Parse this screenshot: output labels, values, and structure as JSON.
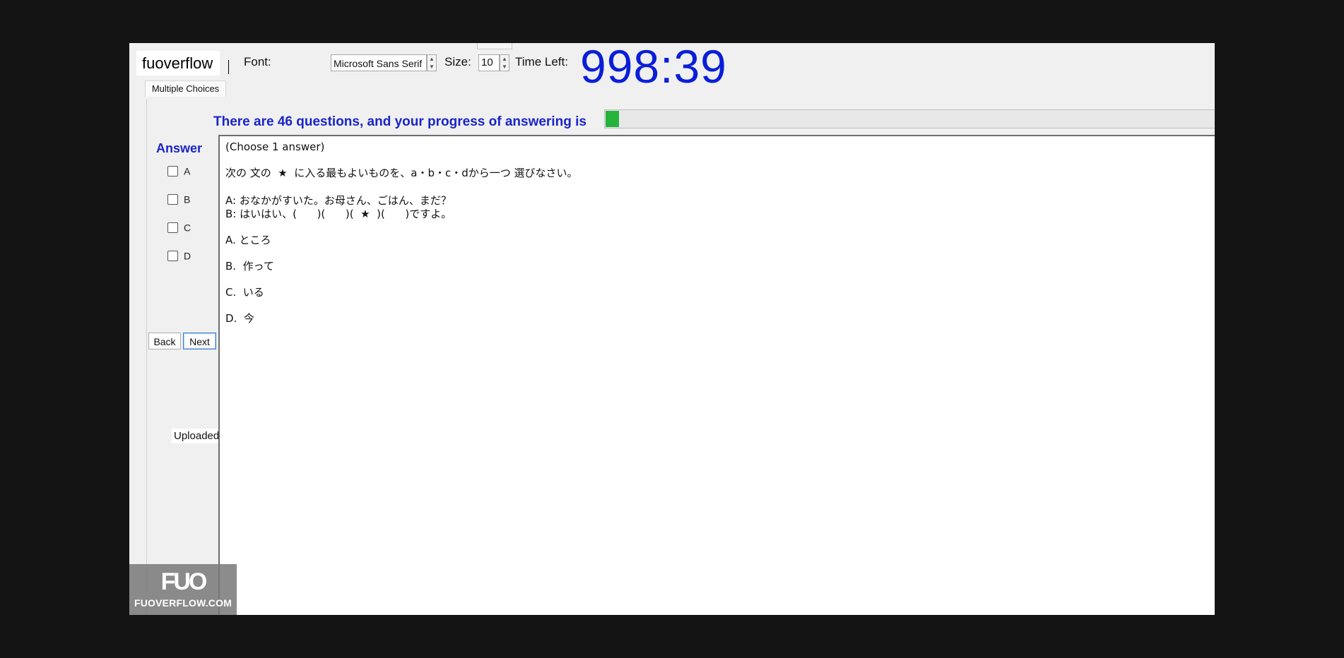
{
  "toolbar": {
    "brand": "fuoverflow",
    "font_label": "Font:",
    "font_value": "Microsoft Sans Serif",
    "size_label": "Size:",
    "size_value": "10",
    "time_left_label": "Time Left:",
    "timer": "998:39"
  },
  "tabs": [
    {
      "label": "Multiple Choices",
      "active": true
    }
  ],
  "progress": {
    "text": "There are 46 questions, and your progress of answering is",
    "fraction": 0.022,
    "fill_color": "#26b33c"
  },
  "answer": {
    "title": "Answer",
    "options": [
      {
        "letter": "A",
        "checked": false
      },
      {
        "letter": "B",
        "checked": false
      },
      {
        "letter": "C",
        "checked": false
      },
      {
        "letter": "D",
        "checked": false
      }
    ]
  },
  "nav": {
    "back": "Back",
    "next": "Next"
  },
  "status": {
    "uploaded": "Uploaded"
  },
  "question": {
    "lines": [
      "(Choose 1 answer)",
      "次の 文の  ★  に入る最もよいものを、a・b・c・dから一つ 選びなさい。",
      "A: おなかがすいた。お母さん、ごはん、まだ？",
      "B: はいはい、(      )(      )(  ★  )(      )ですよ。",
      "A. ところ",
      "B.  作って",
      "C.  いる",
      "D.  今"
    ]
  },
  "watermark": {
    "logo": "FUO",
    "site": "FUOVERFLOW.COM"
  },
  "colors": {
    "timer": "#0a1ed8",
    "accent_text": "#1a24c7"
  }
}
